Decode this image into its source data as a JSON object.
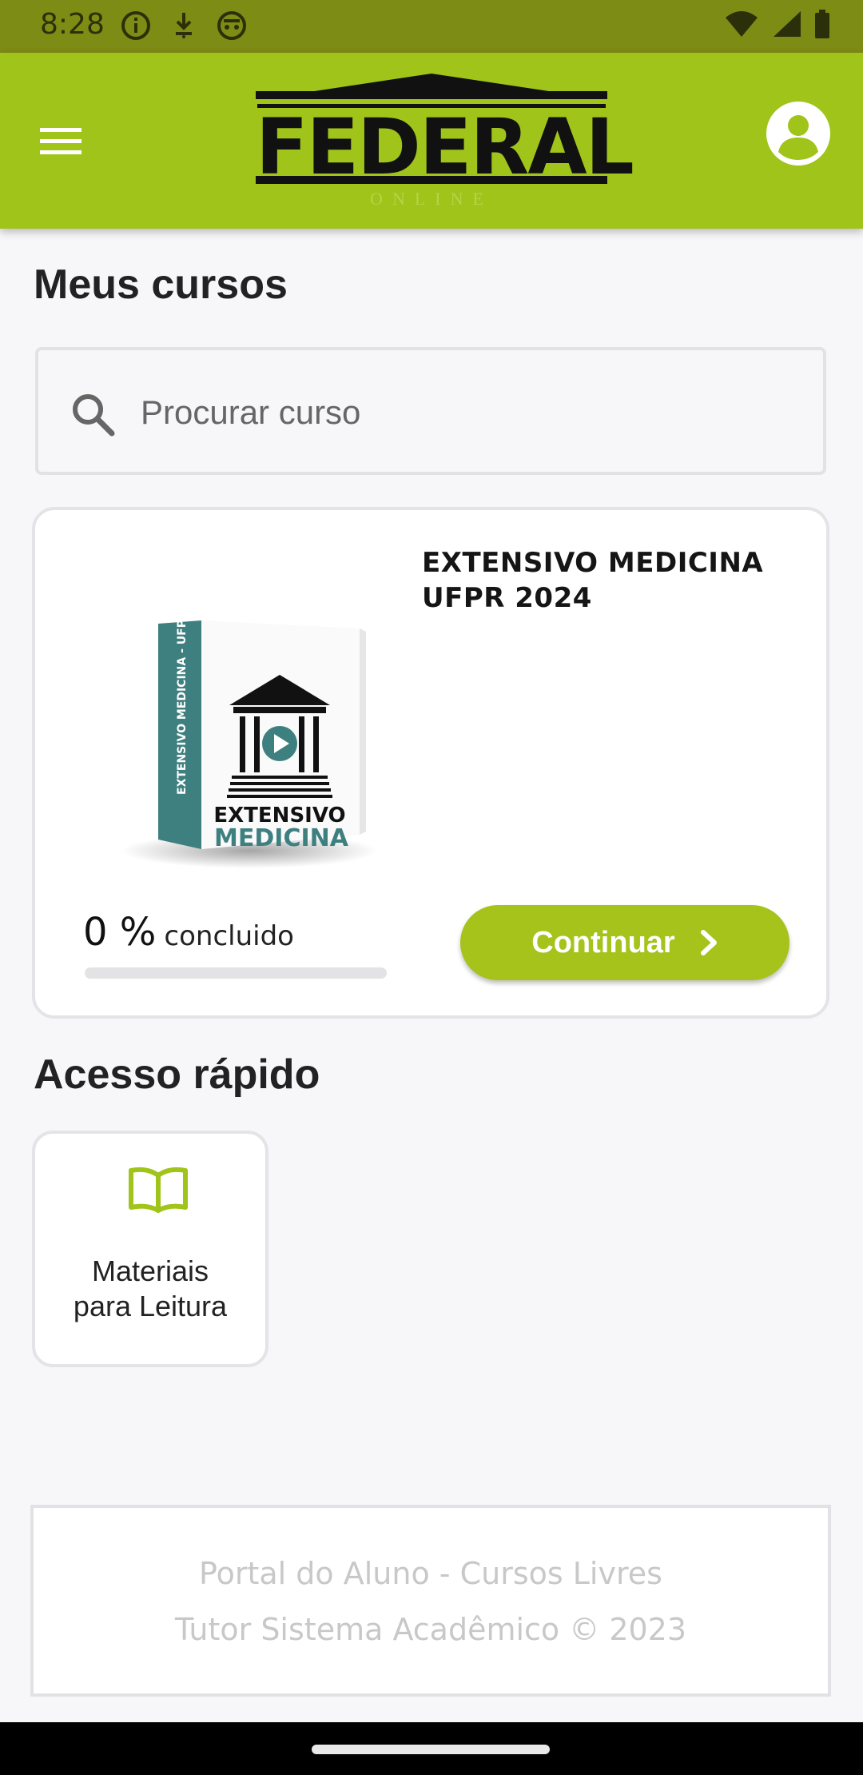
{
  "status_bar": {
    "time": "8:28",
    "icons_left": [
      "info-icon",
      "download-icon",
      "android-icon"
    ],
    "icons_right": [
      "wifi-icon",
      "signal-icon",
      "battery-icon"
    ]
  },
  "app_bar": {
    "logo_text": "FEDERAL",
    "logo_subtext": "ONLINE",
    "menu_icon": "hamburger-menu-icon",
    "account_icon": "account-circle-icon",
    "background_color": "#a0c41a"
  },
  "page": {
    "title": "Meus cursos"
  },
  "search": {
    "placeholder": "Procurar curso",
    "value": ""
  },
  "course": {
    "title": "EXTENSIVO MEDICINA UFPR 2024",
    "cover": {
      "spine_text": "EXTENSIVO MEDICINA - UFPR",
      "line1": "EXTENSIVO",
      "line2": "MEDICINA"
    },
    "progress_percent_label": "0 %",
    "progress_text": "concluido",
    "progress_fraction": 0,
    "continue_label": "Continuar"
  },
  "quick_access": {
    "title": "Acesso rápido",
    "items": [
      {
        "label": "Materiais\npara Leitura",
        "icon": "open-book-icon"
      }
    ]
  },
  "footer": {
    "line1": "Portal do Aluno - Cursos Livres",
    "line2": "Tutor Sistema Acadêmico © 2023"
  },
  "colors": {
    "accent": "#a0c41a",
    "status_bar": "#7d8c14",
    "cover_teal": "#3e7f80"
  }
}
